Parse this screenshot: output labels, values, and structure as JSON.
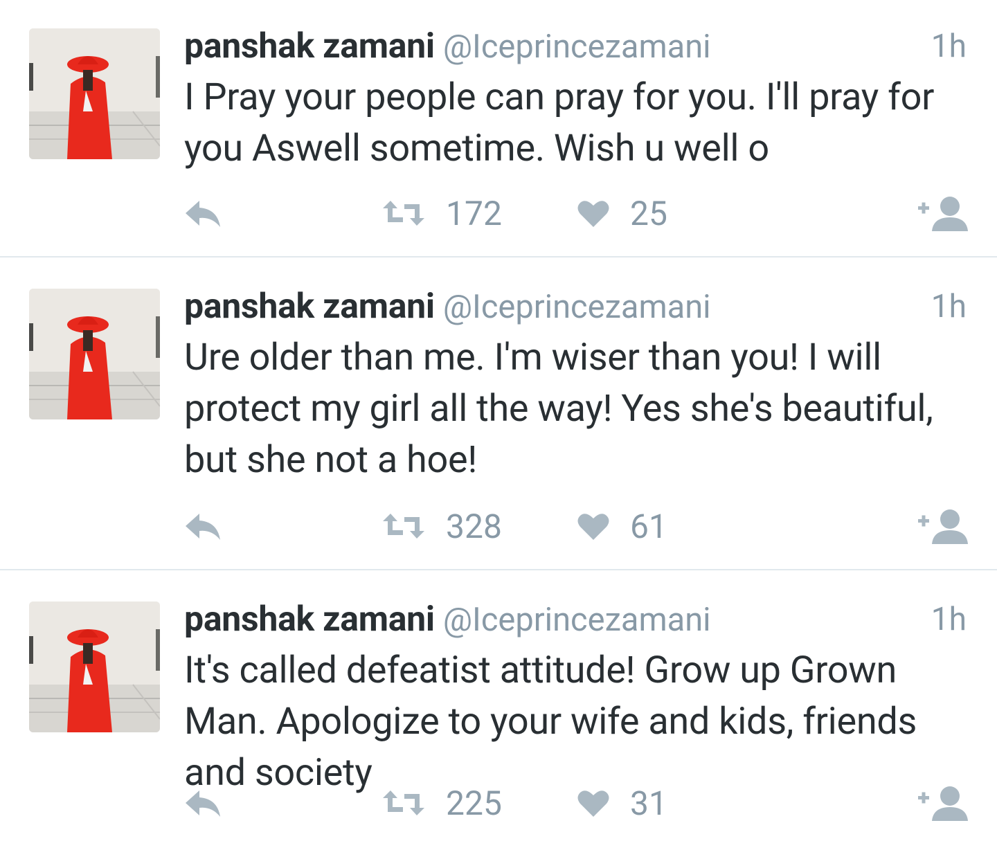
{
  "colors": {
    "name": "#292f33",
    "meta": "#8899a6",
    "icon": "#aab8c2",
    "divider": "#e1e8ed",
    "avatar_suit": "#ea2a1f"
  },
  "icons": {
    "reply": "reply-arrow-icon",
    "retweet": "retweet-icon",
    "like": "heart-icon",
    "follow": "add-user-icon"
  },
  "tweets": [
    {
      "name": "panshak zamani",
      "handle": "@Iceprincezamani",
      "time": "1h",
      "text": "I Pray your people can pray for you. I'll pray for you Aswell sometime. Wish u well o",
      "retweets": "172",
      "likes": "25"
    },
    {
      "name": "panshak zamani",
      "handle": "@Iceprincezamani",
      "time": "1h",
      "text": "Ure older than me. I'm wiser than you! I will protect my girl all the way! Yes she's beautiful, but she not a hoe!",
      "retweets": "328",
      "likes": "61"
    },
    {
      "name": "panshak zamani",
      "handle": "@Iceprincezamani",
      "time": "1h",
      "text": "It's called defeatist attitude! Grow up Grown Man. Apologize to your wife and kids, friends and society",
      "retweets": "225",
      "likes": "31"
    }
  ]
}
